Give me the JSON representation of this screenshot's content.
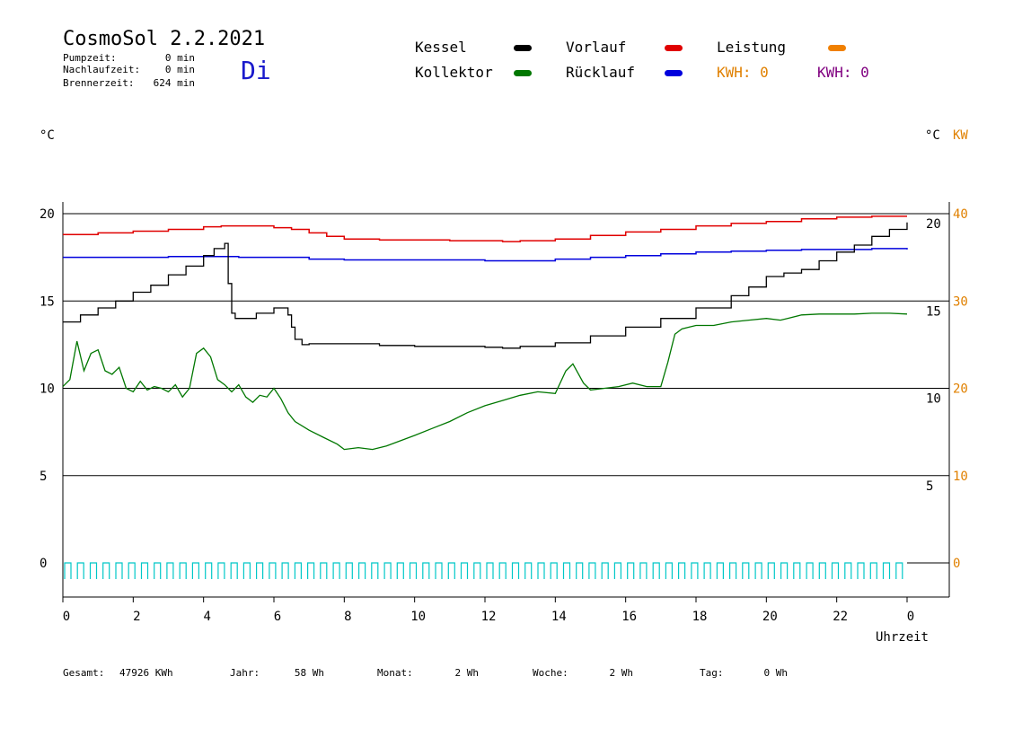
{
  "header": {
    "title": "CosmoSol 2.2.2021",
    "weekday": "Di",
    "stats": [
      {
        "label": "Pumpzeit:",
        "value": "0 min"
      },
      {
        "label": "Nachlaufzeit:",
        "value": "0 min"
      },
      {
        "label": "Brennerzeit:",
        "value": "624 min"
      }
    ]
  },
  "legend": {
    "items": [
      {
        "label": "Kessel",
        "color": "#000000"
      },
      {
        "label": "Kollektor",
        "color": "#007700"
      },
      {
        "label": "Vorlauf",
        "color": "#e00000"
      },
      {
        "label": "Rücklauf",
        "color": "#0000dd"
      },
      {
        "label": "Leistung",
        "color": "#f08000"
      }
    ],
    "kwh": [
      {
        "label": "KWH: 0",
        "color": "#e08000"
      },
      {
        "label": "KWH: 0",
        "color": "#800080"
      }
    ]
  },
  "axes": {
    "left_unit": "°C",
    "right_unit": "°C",
    "right_unit2": "KW",
    "x_label": "Uhrzeit"
  },
  "footer": [
    {
      "label": "Gesamt:",
      "value": "47926 KWh"
    },
    {
      "label": "Jahr:",
      "value": "58 Wh"
    },
    {
      "label": "Monat:",
      "value": "2 Wh"
    },
    {
      "label": "Woche:",
      "value": "2 Wh"
    },
    {
      "label": "Tag:",
      "value": "0 Wh"
    }
  ],
  "chart_data": {
    "type": "line",
    "title": "CosmoSol 2.2.2021",
    "xlabel": "Uhrzeit",
    "ylabel": "°C",
    "xlim": [
      0,
      24
    ],
    "ylim": [
      -1.5,
      21
    ],
    "y_ticks_left": [
      0,
      5,
      10,
      15,
      20
    ],
    "y_ticks_right_celsius": [
      5,
      10,
      15,
      20
    ],
    "y_ticks_right_kw": [
      0,
      10,
      20,
      30,
      40
    ],
    "x_ticks": [
      "0",
      "2",
      "4",
      "6",
      "8",
      "10",
      "12",
      "14",
      "16",
      "18",
      "20",
      "22",
      "0"
    ],
    "grid": "horizontal",
    "series": [
      {
        "name": "Vorlauf",
        "color": "#e00000",
        "step": true,
        "x": [
          0,
          1,
          2,
          3,
          4,
          4.5,
          5,
          6,
          6.5,
          7,
          7.5,
          8,
          9,
          10,
          11,
          12,
          12.5,
          13,
          14,
          15,
          16,
          17,
          18,
          19,
          20,
          21,
          22,
          23,
          24
        ],
        "y": [
          18.8,
          18.9,
          19.0,
          19.1,
          19.25,
          19.3,
          19.3,
          19.2,
          19.1,
          18.9,
          18.7,
          18.55,
          18.5,
          18.5,
          18.45,
          18.45,
          18.4,
          18.45,
          18.55,
          18.75,
          18.95,
          19.1,
          19.3,
          19.45,
          19.55,
          19.7,
          19.8,
          19.85,
          19.85
        ]
      },
      {
        "name": "Rücklauf",
        "color": "#0000dd",
        "step": true,
        "x": [
          0,
          2,
          3,
          4,
          5,
          6,
          7,
          8,
          9,
          10,
          11,
          12,
          13,
          14,
          15,
          16,
          17,
          18,
          19,
          20,
          21,
          22,
          23,
          24
        ],
        "y": [
          17.5,
          17.5,
          17.55,
          17.55,
          17.5,
          17.5,
          17.4,
          17.35,
          17.35,
          17.35,
          17.35,
          17.3,
          17.3,
          17.4,
          17.5,
          17.6,
          17.7,
          17.8,
          17.85,
          17.9,
          17.95,
          17.95,
          18.0,
          17.95
        ]
      },
      {
        "name": "Kessel",
        "color": "#000000",
        "step": true,
        "x": [
          0,
          0.5,
          1,
          1.5,
          2,
          2.5,
          3,
          3.5,
          4,
          4.3,
          4.6,
          4.7,
          4.8,
          4.9,
          5.0,
          5.5,
          6.0,
          6.2,
          6.4,
          6.5,
          6.6,
          6.8,
          7,
          8,
          9,
          10,
          11,
          12,
          12.5,
          13,
          14,
          15,
          16,
          17,
          18,
          19,
          19.5,
          20,
          20.5,
          21,
          21.5,
          22,
          22.5,
          23,
          23.5,
          24
        ],
        "y": [
          13.8,
          14.2,
          14.6,
          15.0,
          15.5,
          15.9,
          16.5,
          17.0,
          17.6,
          18.0,
          18.3,
          16.0,
          14.3,
          14.0,
          14.0,
          14.3,
          14.6,
          14.6,
          14.2,
          13.5,
          12.8,
          12.5,
          12.55,
          12.55,
          12.45,
          12.4,
          12.4,
          12.35,
          12.3,
          12.4,
          12.6,
          13.0,
          13.5,
          14.0,
          14.6,
          15.3,
          15.8,
          16.4,
          16.6,
          16.8,
          17.3,
          17.8,
          18.2,
          18.7,
          19.1,
          19.5
        ]
      },
      {
        "name": "Kollektor",
        "color": "#007700",
        "step": false,
        "x": [
          0,
          0.2,
          0.4,
          0.6,
          0.8,
          1.0,
          1.2,
          1.4,
          1.6,
          1.8,
          2.0,
          2.2,
          2.4,
          2.6,
          2.8,
          3.0,
          3.2,
          3.4,
          3.6,
          3.8,
          4.0,
          4.2,
          4.4,
          4.6,
          4.8,
          5.0,
          5.2,
          5.4,
          5.6,
          5.8,
          6.0,
          6.2,
          6.4,
          6.6,
          7.0,
          7.4,
          7.8,
          8.0,
          8.4,
          8.8,
          9.2,
          9.6,
          10.0,
          10.5,
          11.0,
          11.5,
          12.0,
          12.5,
          13.0,
          13.5,
          14.0,
          14.3,
          14.5,
          14.8,
          15.0,
          15.4,
          15.8,
          16.2,
          16.6,
          17.0,
          17.2,
          17.4,
          17.6,
          17.8,
          18.0,
          18.5,
          19.0,
          19.5,
          20.0,
          20.4,
          20.6,
          21.0,
          21.5,
          22.0,
          22.5,
          23.0,
          23.5,
          24.0
        ],
        "y": [
          10.1,
          10.5,
          12.7,
          11.0,
          12.0,
          12.2,
          11.0,
          10.8,
          11.2,
          10.0,
          9.8,
          10.4,
          9.9,
          10.1,
          10.0,
          9.8,
          10.2,
          9.5,
          10.0,
          12.0,
          12.3,
          11.8,
          10.5,
          10.2,
          9.8,
          10.2,
          9.5,
          9.2,
          9.6,
          9.5,
          10.0,
          9.4,
          8.6,
          8.1,
          7.6,
          7.2,
          6.8,
          6.5,
          6.6,
          6.5,
          6.7,
          7.0,
          7.3,
          7.7,
          8.1,
          8.6,
          9.0,
          9.3,
          9.6,
          9.8,
          9.7,
          11.0,
          11.4,
          10.3,
          9.9,
          10.0,
          10.1,
          10.3,
          10.1,
          10.1,
          11.5,
          13.1,
          13.4,
          13.5,
          13.6,
          13.6,
          13.8,
          13.9,
          14.0,
          13.9,
          14.0,
          14.2,
          14.25,
          14.25,
          14.25,
          14.3,
          14.3,
          14.25
        ]
      },
      {
        "name": "Leistung",
        "color": "#00c8c8",
        "pulse": true,
        "x": [
          0,
          24
        ],
        "y": [
          0,
          0
        ]
      }
    ]
  }
}
